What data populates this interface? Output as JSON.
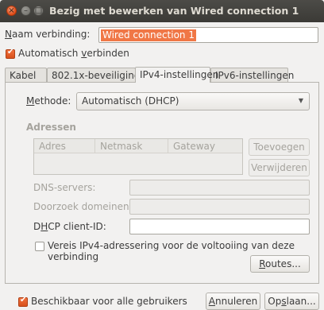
{
  "window": {
    "title": "Bezig met bewerken van Wired connection 1"
  },
  "name_row": {
    "label_before": "",
    "label_mn": "N",
    "label_after": "aam verbinding:",
    "value": "Wired connection 1"
  },
  "auto_connect": {
    "pre": "Automatisch ",
    "mn": "v",
    "post": "erbinden",
    "checked": true
  },
  "tabs": [
    {
      "label": "Kabel",
      "active": false
    },
    {
      "label": "802.1x-beveiliging",
      "active": false
    },
    {
      "label": "IPv4-instellingen",
      "active": true
    },
    {
      "label": "IPv6-instellingen",
      "active": false
    }
  ],
  "ipv4": {
    "method_label_mn": "M",
    "method_label_rest": "ethode:",
    "method_value": "Automatisch (DHCP)",
    "addresses_heading": "Adressen",
    "columns": [
      "Adres",
      "Netmask",
      "Gateway"
    ],
    "add_button": "Toevoegen",
    "remove_button": "Verwijderen",
    "dns_label": "DNS-servers:",
    "search_domains_label": "Doorzoek domeinen:",
    "dhcp_label_pre": "D",
    "dhcp_label_mn": "H",
    "dhcp_label_post": "CP client-ID:",
    "require_ipv4": "Vereis IPv4-adressering voor de voltooiing van deze verbinding",
    "routes_mn": "R",
    "routes_rest": "outes..."
  },
  "footer": {
    "all_users": "Beschikbaar voor alle gebruikers",
    "all_users_checked": true,
    "cancel_mn": "A",
    "cancel_rest": "nnuleren",
    "save_pre": "Op",
    "save_mn": "s",
    "save_post": "laan..."
  },
  "colors": {
    "accent": "#f07746",
    "titlebar": "#3c3b37",
    "background": "#f2f1f0"
  }
}
